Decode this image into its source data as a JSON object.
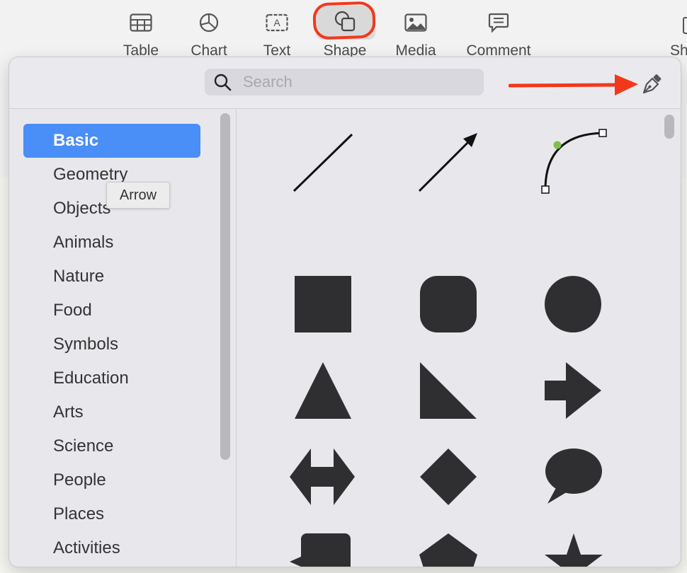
{
  "toolbar": {
    "items": [
      {
        "label": "Table",
        "icon": "table-icon"
      },
      {
        "label": "Chart",
        "icon": "chart-icon"
      },
      {
        "label": "Text",
        "icon": "text-box-icon"
      },
      {
        "label": "Shape",
        "icon": "shape-icon"
      },
      {
        "label": "Media",
        "icon": "media-icon"
      },
      {
        "label": "Comment",
        "icon": "comment-icon"
      },
      {
        "label": "Sh",
        "icon": "share-icon"
      }
    ],
    "selected": "Shape"
  },
  "shape_library": {
    "search": {
      "placeholder": "Search",
      "value": ""
    },
    "pen_tool_icon": "pen-icon",
    "categories": [
      "Basic",
      "Geometry",
      "Objects",
      "Animals",
      "Nature",
      "Food",
      "Symbols",
      "Education",
      "Arts",
      "Science",
      "People",
      "Places",
      "Activities"
    ],
    "selected_category": "Basic",
    "tooltip": "Arrow",
    "shapes": [
      "line",
      "arrow-line",
      "curve",
      "square",
      "rounded-square",
      "circle",
      "triangle",
      "right-triangle",
      "arrow",
      "double-arrow",
      "diamond",
      "speech-bubble",
      "callout-square",
      "pentagon",
      "star"
    ]
  },
  "colors": {
    "accent": "#4a8ef7",
    "annotation": "#f2381c",
    "shape_fill": "#2f2f31",
    "curve_point": "#7cc24a"
  }
}
